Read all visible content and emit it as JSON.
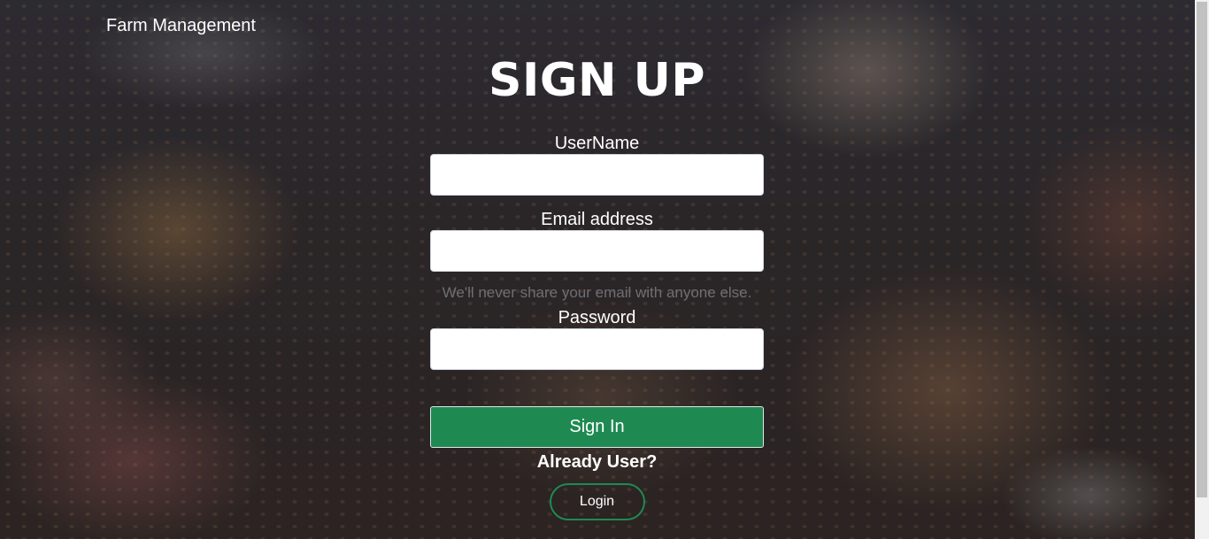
{
  "brand": {
    "title": "Farm Management"
  },
  "signup_form": {
    "heading": "SIGN UP",
    "username": {
      "label": "UserName",
      "value": "",
      "placeholder": ""
    },
    "email": {
      "label": "Email address",
      "value": "",
      "placeholder": "",
      "help_text": "We'll never share your email with anyone else."
    },
    "password": {
      "label": "Password",
      "value": "",
      "placeholder": ""
    },
    "submit_label": "Sign In",
    "already_user_text": "Already User?",
    "login_label": "Login"
  },
  "colors": {
    "primary_green": "#1e8a52",
    "background_overlay": "#2a2628",
    "text": "#ffffff",
    "muted_text": "#6f6f73"
  }
}
